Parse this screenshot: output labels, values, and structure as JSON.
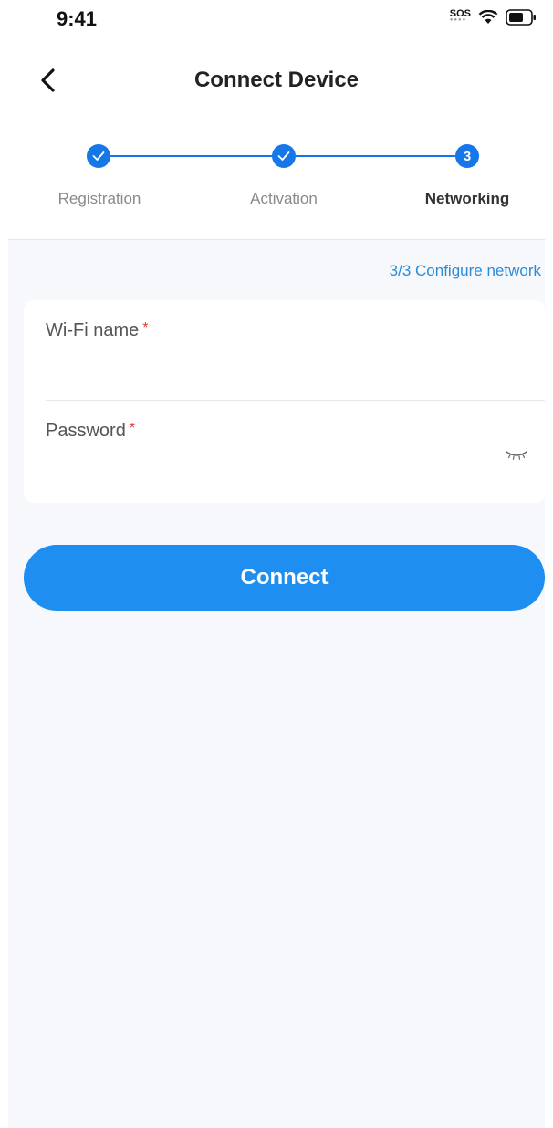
{
  "status_bar": {
    "time": "9:41",
    "sos": "SOS"
  },
  "nav": {
    "title": "Connect Device",
    "back_icon": "chevron-left-icon"
  },
  "stepper": {
    "steps": [
      {
        "label": "Registration",
        "state": "done",
        "marker": "check-icon"
      },
      {
        "label": "Activation",
        "state": "done",
        "marker": "check-icon"
      },
      {
        "label": "Networking",
        "state": "current",
        "marker": "3"
      }
    ],
    "accent_color": "#1677e8"
  },
  "hint": "3/3 Configure network",
  "form": {
    "wifi": {
      "label": "Wi-Fi name",
      "required_mark": "*",
      "value": ""
    },
    "password": {
      "label": "Password",
      "required_mark": "*",
      "value": "",
      "toggle_icon": "eye-closed-icon"
    }
  },
  "connect_button": {
    "label": "Connect",
    "color": "#1e8ff0"
  }
}
